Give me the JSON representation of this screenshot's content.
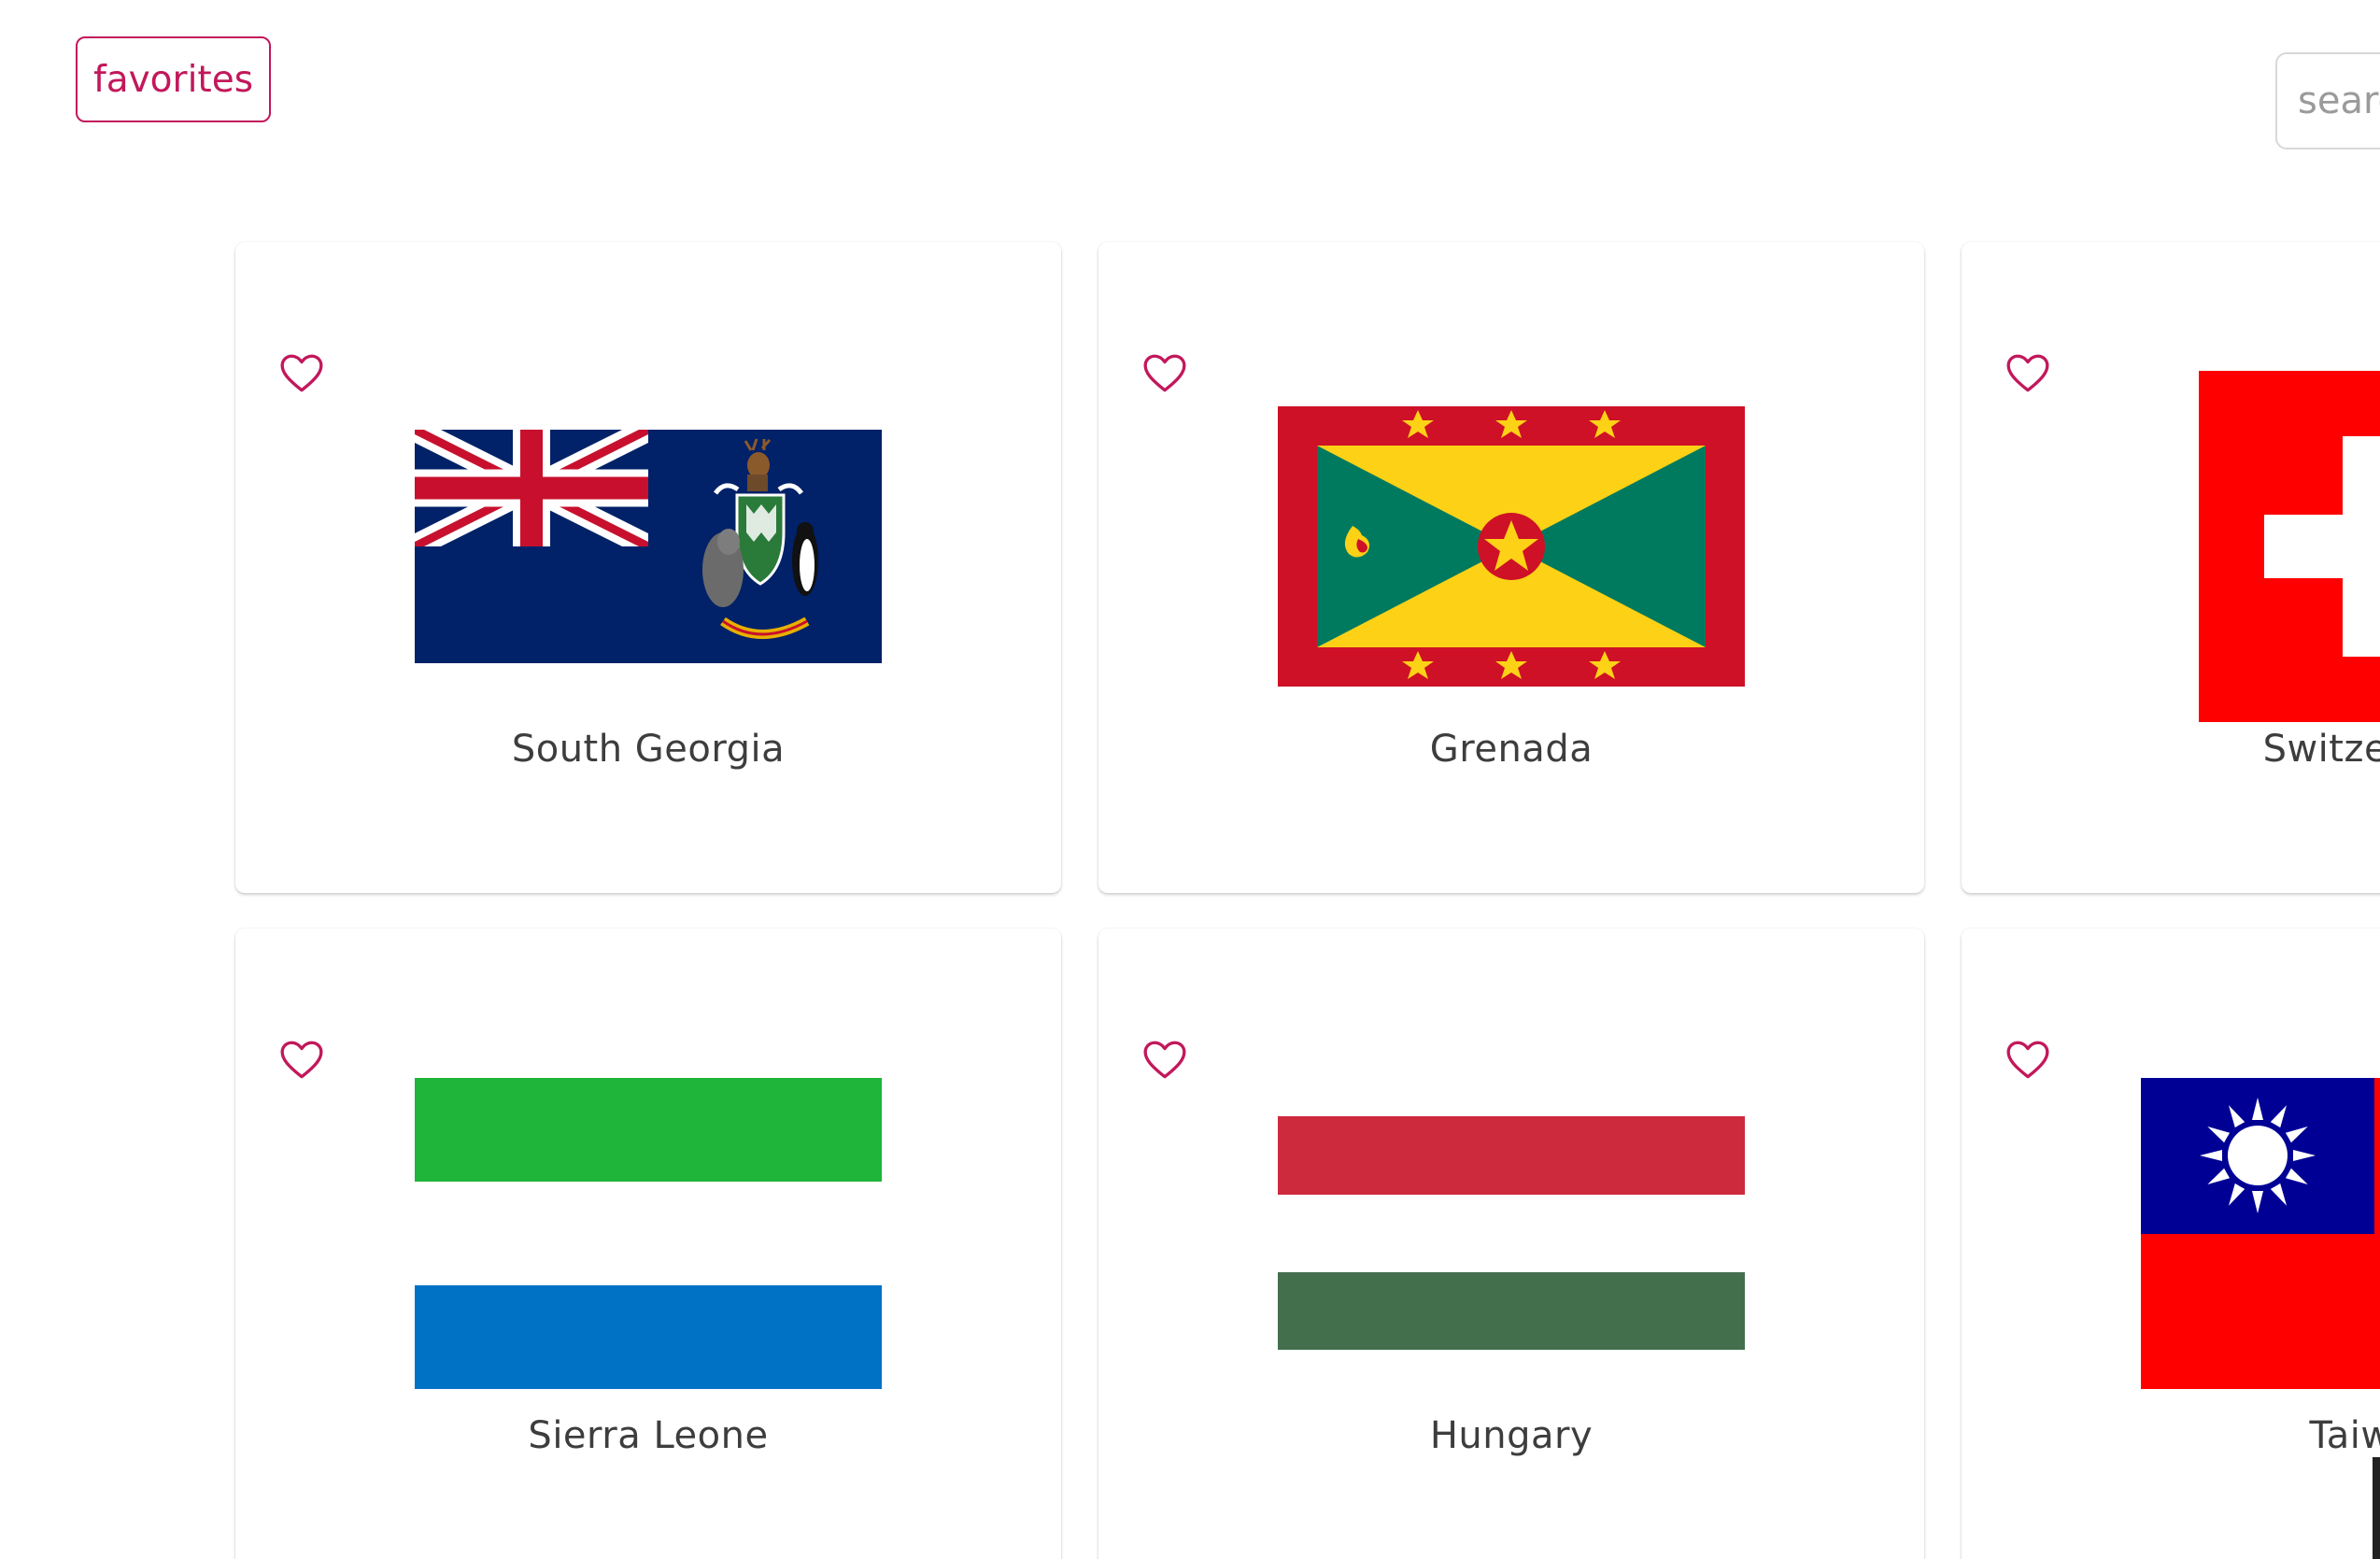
{
  "header": {
    "favorites_label": "favorites",
    "search_placeholder": "search"
  },
  "colors": {
    "accent": "#c2185b",
    "text": "#3d3d3d",
    "card_background": "#ffffff"
  },
  "countries": [
    {
      "name": "South Georgia",
      "flag_icon": "south-georgia-flag"
    },
    {
      "name": "Grenada",
      "flag_icon": "grenada-flag"
    },
    {
      "name": "Switzerland",
      "flag_icon": "switzerland-flag"
    },
    {
      "name": "Sierra Leone",
      "flag_icon": "sierra-leone-flag"
    },
    {
      "name": "Hungary",
      "flag_icon": "hungary-flag"
    },
    {
      "name": "Taiwan",
      "flag_icon": "taiwan-flag"
    }
  ],
  "favorite_icon": "heart-outline-icon"
}
